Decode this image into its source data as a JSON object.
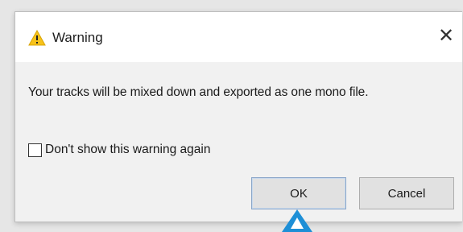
{
  "dialog": {
    "title": "Warning",
    "title_icon": "warning-triangle-icon",
    "close_icon": "close-icon",
    "close_glyph": "✕",
    "message": "Your tracks will be mixed down and exported as one mono file.",
    "checkbox": {
      "label": "Don't show this warning again",
      "checked": false
    },
    "buttons": {
      "ok": "OK",
      "cancel": "Cancel"
    }
  },
  "colors": {
    "warning_fill": "#f7c21a",
    "pointer_arrow": "#1e8fd6"
  }
}
